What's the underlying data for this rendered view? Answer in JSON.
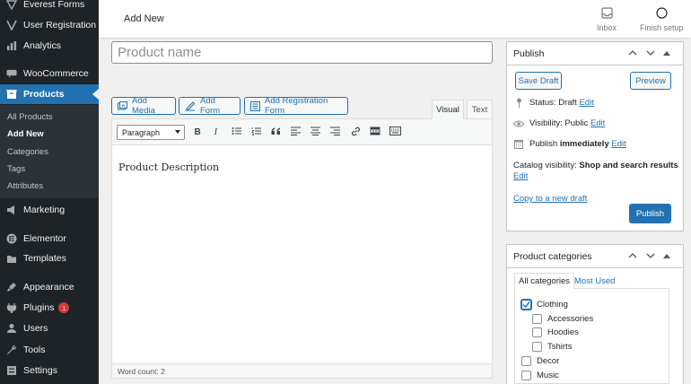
{
  "sidebar": {
    "menu": [
      {
        "label": "Everest Forms",
        "icon": "everest-forms-icon"
      },
      {
        "label": "User Registration",
        "icon": "user-registration-icon"
      },
      {
        "label": "Analytics",
        "icon": "analytics-icon"
      },
      {
        "label": "WooCommerce",
        "icon": "woocommerce-icon"
      },
      {
        "label": "Products",
        "icon": "products-icon"
      },
      {
        "label": "Marketing",
        "icon": "marketing-icon"
      },
      {
        "label": "Elementor",
        "icon": "elementor-icon"
      },
      {
        "label": "Templates",
        "icon": "templates-icon"
      },
      {
        "label": "Appearance",
        "icon": "appearance-icon"
      },
      {
        "label": "Plugins",
        "icon": "plugins-icon",
        "badge": "1"
      },
      {
        "label": "Users",
        "icon": "users-icon"
      },
      {
        "label": "Tools",
        "icon": "tools-icon"
      },
      {
        "label": "Settings",
        "icon": "settings-icon"
      }
    ],
    "submenu": [
      "All Products",
      "Add New",
      "Categories",
      "Tags",
      "Attributes"
    ]
  },
  "header": {
    "title": "Add New",
    "inbox_label": "Inbox",
    "finish_label": "Finish setup"
  },
  "title_field": {
    "placeholder": "Product name",
    "value": ""
  },
  "media_buttons": {
    "add_media": "Add Media",
    "add_form": "Add Form",
    "add_registration_form": "Add Registration Form"
  },
  "editor": {
    "tab_visual": "Visual",
    "tab_text": "Text",
    "format": "Paragraph",
    "content": "Product Description",
    "word_count": "Word count: 2"
  },
  "publish": {
    "title": "Publish",
    "save_draft": "Save Draft",
    "preview": "Preview",
    "status_label": "Status:",
    "status_value": "Draft",
    "visibility_label": "Visibility:",
    "visibility_value": "Public",
    "publish_label": "Publish",
    "publish_value": "immediately",
    "edit": "Edit",
    "catalog_label": "Catalog visibility:",
    "catalog_value": "Shop and search results",
    "copy_draft": "Copy to a new draft",
    "publish_button": "Publish"
  },
  "categories": {
    "title": "Product categories",
    "tab_all": "All categories",
    "tab_most_used": "Most Used",
    "items": [
      {
        "label": "Clothing",
        "checked": true,
        "level": 0
      },
      {
        "label": "Accessories",
        "checked": false,
        "level": 1
      },
      {
        "label": "Hoodies",
        "checked": false,
        "level": 1
      },
      {
        "label": "Tshirts",
        "checked": false,
        "level": 1
      },
      {
        "label": "Decor",
        "checked": false,
        "level": 0
      },
      {
        "label": "Music",
        "checked": false,
        "level": 0
      }
    ]
  },
  "colors": {
    "accent": "#2271b1",
    "sidebar": "#1d2327",
    "badge": "#d63638"
  }
}
